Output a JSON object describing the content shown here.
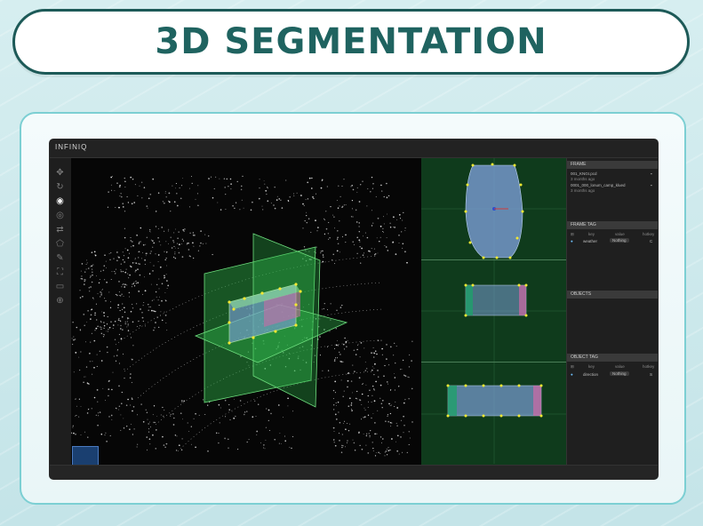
{
  "title": "3D SEGMENTATION",
  "app": {
    "logo": "INFINIQ",
    "tools": [
      "move-icon",
      "rotate-icon",
      "target-icon",
      "circle-icon",
      "route-icon",
      "polygon-icon",
      "brush-icon",
      "expand-icon",
      "monitor-icon",
      "zoom-icon"
    ],
    "active_tool_index": 2
  },
  "panel": {
    "frame_header": "FRAME",
    "frames": [
      {
        "name": "001_KNGI.pcd",
        "time": "3 months ago"
      },
      {
        "name": "0001_000_lonum_camp_klued",
        "time": "3 months ago"
      }
    ],
    "frame_tag_header": "FRAME TAG",
    "frame_tag_row": {
      "key": "weather",
      "value": "Nothing",
      "extra": "C"
    },
    "objects_header": "OBJECTS",
    "object_tag_header": "OBJECT TAG",
    "table_headers": [
      "key",
      "value",
      "hotkey"
    ],
    "object_tag_row": {
      "key": "direction",
      "value": "Nothing",
      "extra": "S"
    }
  },
  "colors": {
    "title_text": "#1f6360",
    "frame_border": "#7ccfd3",
    "side_view_bg": "#0f3b1c",
    "plane_green": "#2fb54a",
    "box_blue": "#7a9ed6",
    "vertex_yellow": "#f2e832"
  }
}
